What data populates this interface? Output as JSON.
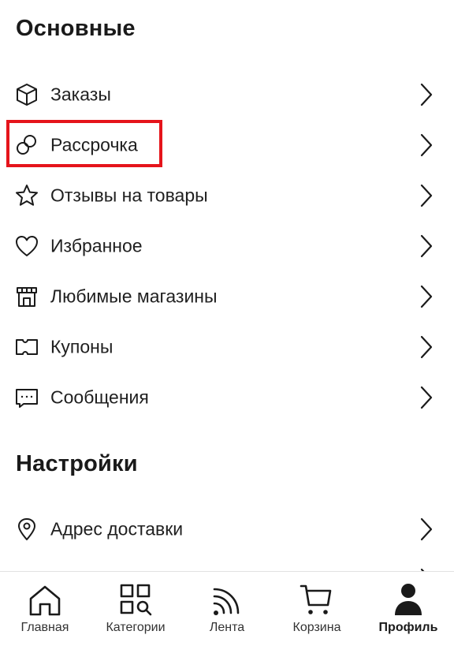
{
  "colors": {
    "text": "#1a1a1a",
    "highlight": "#e5141b",
    "divider": "#e2e2e2"
  },
  "sections": {
    "main_title": "Основные",
    "settings_title": "Настройки"
  },
  "main_items": [
    {
      "label": "Заказы",
      "icon": "box-icon"
    },
    {
      "label": "Рассрочка",
      "icon": "installment-icon",
      "highlighted": true
    },
    {
      "label": "Отзывы на товары",
      "icon": "star-icon"
    },
    {
      "label": "Избранное",
      "icon": "heart-icon"
    },
    {
      "label": "Любимые магазины",
      "icon": "store-icon"
    },
    {
      "label": "Купоны",
      "icon": "coupon-icon"
    },
    {
      "label": "Сообщения",
      "icon": "message-icon"
    }
  ],
  "settings_items": [
    {
      "label": "Адрес доставки",
      "icon": "location-pin-icon"
    }
  ],
  "tabbar": {
    "active": "Профиль",
    "tabs": [
      {
        "label": "Главная",
        "icon": "home-icon"
      },
      {
        "label": "Категории",
        "icon": "categories-icon"
      },
      {
        "label": "Лента",
        "icon": "feed-icon"
      },
      {
        "label": "Корзина",
        "icon": "cart-icon"
      },
      {
        "label": "Профиль",
        "icon": "profile-icon"
      }
    ]
  }
}
